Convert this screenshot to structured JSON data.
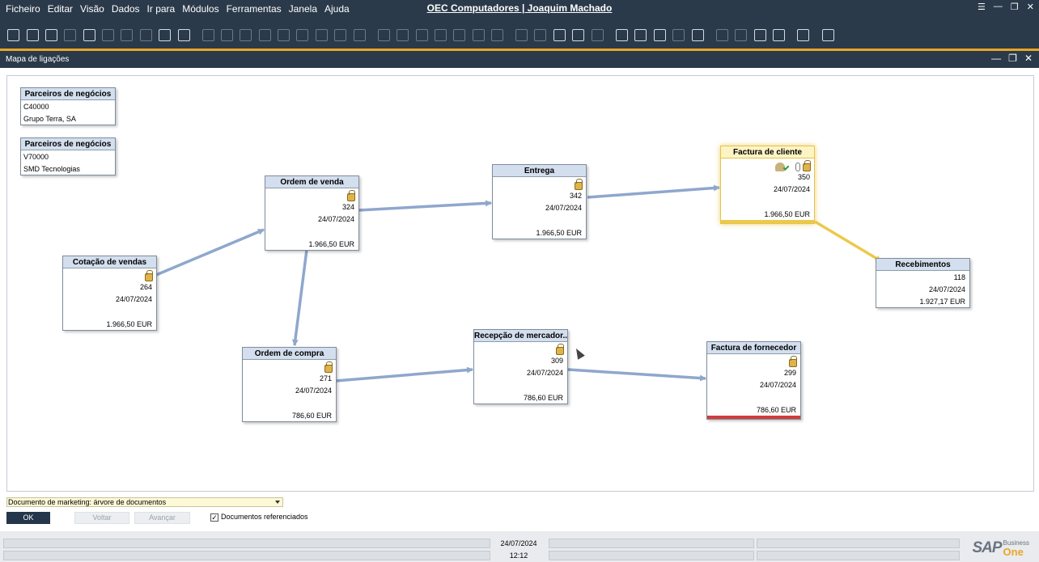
{
  "menu": [
    "Ficheiro",
    "Editar",
    "Visão",
    "Dados",
    "Ir para",
    "Módulos",
    "Ferramentas",
    "Janela",
    "Ajuda"
  ],
  "app_title": "OEC Computadores | Joaquim Machado",
  "window_title": "Mapa de ligações",
  "nodes": {
    "bp1": {
      "title": "Parceiros de negócios",
      "code": "C40000",
      "name": "Grupo Terra, SA"
    },
    "bp2": {
      "title": "Parceiros de negócios",
      "code": "V70000",
      "name": "SMD Tecnologias"
    },
    "quote": {
      "title": "Cotação de vendas",
      "number": "264",
      "date": "24/07/2024",
      "amount": "1.966,50 EUR"
    },
    "order": {
      "title": "Ordem de venda",
      "number": "324",
      "date": "24/07/2024",
      "amount": "1.966,50 EUR"
    },
    "delivery": {
      "title": "Entrega",
      "number": "342",
      "date": "24/07/2024",
      "amount": "1.966,50 EUR"
    },
    "invoice": {
      "title": "Factura de cliente",
      "number": "350",
      "date": "24/07/2024",
      "amount": "1.966,50 EUR"
    },
    "payment": {
      "title": "Recebimentos",
      "number": "118",
      "date": "24/07/2024",
      "amount": "1.927,17 EUR"
    },
    "purchase": {
      "title": "Ordem de compra",
      "number": "271",
      "date": "24/07/2024",
      "amount": "786,60 EUR"
    },
    "receipt": {
      "title": "Recepção de mercador...",
      "number": "309",
      "date": "24/07/2024",
      "amount": "786,60 EUR"
    },
    "apinvoice": {
      "title": "Factura de fornecedor",
      "number": "299",
      "date": "24/07/2024",
      "amount": "786,60 EUR"
    }
  },
  "doc_selector": "Documento de marketing: árvore de documentos",
  "buttons": {
    "ok": "OK",
    "back": "Voltar",
    "forward": "Avançar"
  },
  "referenced_docs_label": "Documentos referenciados",
  "referenced_docs_checked": true,
  "checkbox_mark": "✓",
  "status": {
    "date": "24/07/2024",
    "time": "12:12"
  },
  "logo": {
    "sap": "SAP",
    "business": "Business",
    "one": "One"
  },
  "colors": {
    "chrome": "#2b3a4a",
    "accent": "#e8a628",
    "link": "#8fa7cc",
    "highlight_link": "#ecc94b",
    "node_header": "#d3dfee",
    "error_bar": "#d23c3c",
    "invoice_bar": "#ecc94b"
  },
  "window_controls": {
    "min": "—",
    "restore": "❐",
    "close": "✕",
    "menu": "☰"
  }
}
